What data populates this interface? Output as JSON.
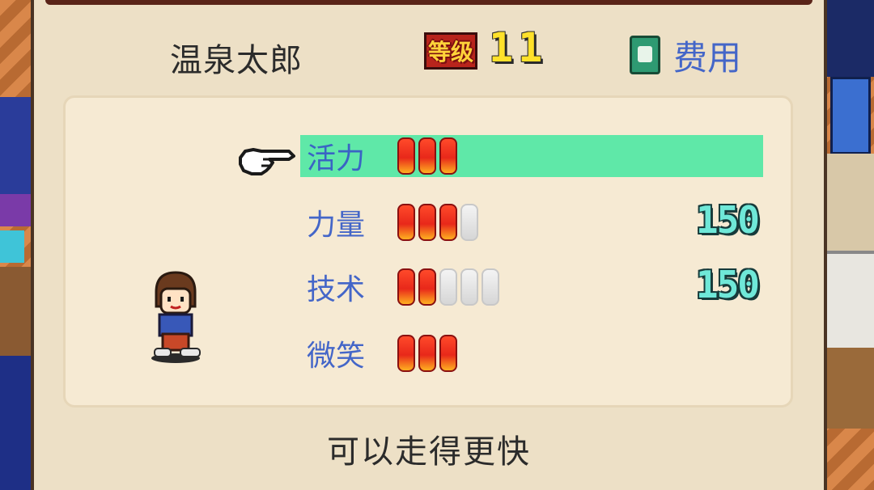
{
  "character": {
    "name": "温泉太郎",
    "level_label": "等级",
    "level": "11"
  },
  "cost_button": {
    "label": "费用",
    "icon": "onsen-book-icon"
  },
  "stats": [
    {
      "label": "活力",
      "filled": 3,
      "total": 3,
      "cost": "",
      "selected": true
    },
    {
      "label": "力量",
      "filled": 3,
      "total": 4,
      "cost": "150",
      "selected": false
    },
    {
      "label": "技术",
      "filled": 2,
      "total": 5,
      "cost": "150",
      "selected": false
    },
    {
      "label": "微笑",
      "filled": 3,
      "total": 3,
      "cost": "",
      "selected": false
    }
  ],
  "description": "可以走得更快",
  "colors": {
    "selected_row": "#5fe8a8",
    "stat_label": "#4466c8",
    "pip_fill": "#e8281a",
    "cost_number": "#6fe8d8",
    "level_number": "#ffe12a"
  }
}
